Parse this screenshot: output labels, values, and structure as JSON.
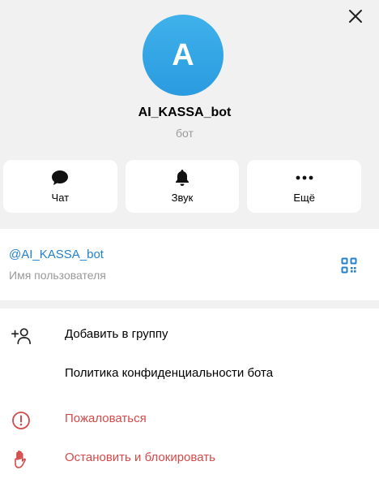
{
  "profile": {
    "avatar_letter": "A",
    "name": "AI_KASSA_bot",
    "subtitle": "бот"
  },
  "actions": [
    {
      "label": "Чат",
      "icon": "chat-bubble-icon"
    },
    {
      "label": "Звук",
      "icon": "bell-icon"
    },
    {
      "label": "Ещё",
      "icon": "more-dots-icon"
    }
  ],
  "info": {
    "username": "@AI_KASSA_bot",
    "username_label": "Имя пользователя",
    "qr_icon": "qr-code-icon"
  },
  "menu": [
    {
      "label": "Добавить в группу",
      "icon": "add-user-icon",
      "danger": false
    },
    {
      "label": "Политика конфиденциальности бота",
      "icon": "",
      "danger": false
    },
    {
      "label": "Пожаловаться",
      "icon": "warning-circle-icon",
      "danger": true
    },
    {
      "label": "Остановить и блокировать",
      "icon": "hand-stop-icon",
      "danger": true
    }
  ],
  "colors": {
    "accent": "#2481cc",
    "danger": "#d44a4a",
    "avatar_top": "#3fb1ea",
    "avatar_bottom": "#2a9be0",
    "background": "#f1f1f1"
  }
}
